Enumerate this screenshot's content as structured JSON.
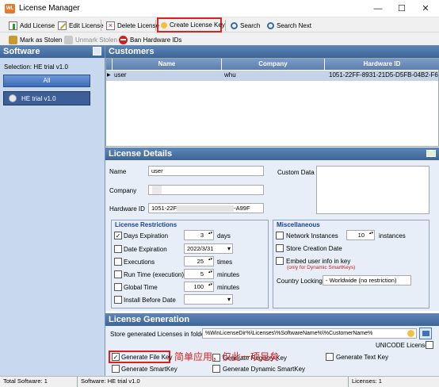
{
  "window": {
    "title": "License Manager",
    "controls": [
      "—",
      "☐",
      "✕"
    ]
  },
  "toolbar1": {
    "add_license": "Add License",
    "edit_license": "Edit License",
    "delete_license": "Delete License",
    "create_license_key": "Create License Key",
    "search": "Search",
    "search_next": "Search Next"
  },
  "toolbar2": {
    "mark_as_stolen": "Mark as Stolen",
    "unmark_stolen": "Unmark Stolen",
    "ban_hardware_ids": "Ban Hardware IDs"
  },
  "software": {
    "header": "Software",
    "selection": "Selection: HE trial v1.0",
    "all_button": "All",
    "items": [
      "HE trial v1.0"
    ]
  },
  "customers": {
    "header": "Customers",
    "columns": [
      "Name",
      "Company",
      "Hardware ID"
    ],
    "rows": [
      {
        "name": "user",
        "company": "whu",
        "hardware_id": "1051-22FF-8931-21D5-D5FB-04B2-F6B2-A"
      }
    ]
  },
  "details": {
    "header": "License Details",
    "name_label": "Name",
    "name_value": "user",
    "company_label": "Company",
    "hardware_label": "Hardware ID",
    "hardware_value_start": "1051-22F",
    "hardware_value_end": "-A99F",
    "custom_data_label": "Custom Data"
  },
  "restrictions": {
    "header": "License Restrictions",
    "days_expiration": {
      "label": "Days Expiration",
      "checked": true,
      "value": "3",
      "unit": "days"
    },
    "date_expiration": {
      "label": "Date Expiration",
      "checked": false,
      "value": "2022/3/31"
    },
    "executions": {
      "label": "Executions",
      "checked": false,
      "value": "25",
      "unit": "times"
    },
    "run_time": {
      "label": "Run Time (execution)",
      "checked": false,
      "value": "5",
      "unit": "minutes"
    },
    "global_time": {
      "label": "Global Time",
      "checked": false,
      "value": "100",
      "unit": "minutes"
    },
    "install_before": {
      "label": "Install Before Date",
      "checked": false,
      "value": ""
    }
  },
  "misc": {
    "header": "Miscellaneous",
    "network_instances": {
      "label": "Network Instances",
      "value": "10",
      "unit": "instances"
    },
    "store_creation_date": "Store Creation Date",
    "embed_user_info": "Embed user info in key",
    "embed_note": "(only for Dynamic SmartKeys)",
    "country_locking_label": "Country Locking",
    "country_locking_value": "- Worldwide (no restriction)"
  },
  "generation": {
    "header": "License Generation",
    "folder_label": "Store generated Licenses in folder:",
    "folder_value": "%WinLicenseDir%\\Licenses\\%SoftwareName%\\%CustomerName%",
    "unicode_label": "UNICODE License",
    "generate_file_key": "Generate File Key",
    "generate_registry_key": "Generate Registry Key",
    "generate_text_key": "Generate Text Key",
    "generate_smartkey": "Generate SmartKey",
    "generate_dynamic_smartkey": "Generate Dynamic SmartKey",
    "annotation": "简单应用，仅此一项足矣"
  },
  "status": {
    "total_software": "Total Software: 1",
    "software": "Software: HE trial v1.0",
    "licenses": "Licenses: 1"
  },
  "colors": {
    "header_blue": "#3d6598",
    "panel_bg": "#e7eef8",
    "highlight": "#e02020",
    "annotation": "#e02020"
  }
}
